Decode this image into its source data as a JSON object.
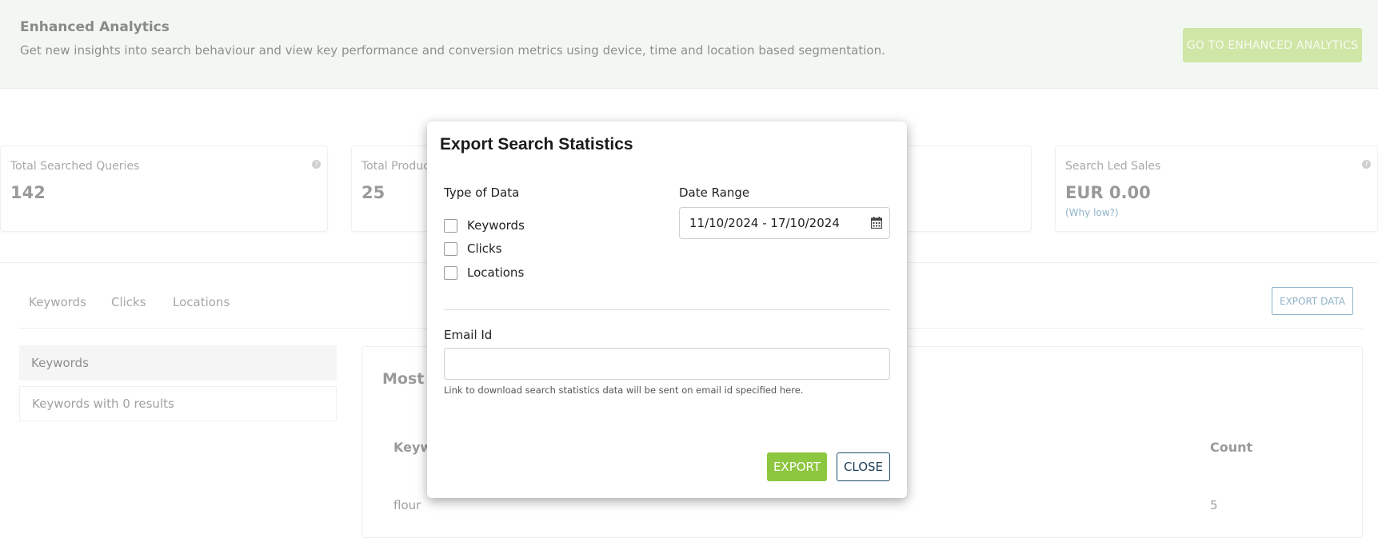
{
  "banner": {
    "title": "Enhanced Analytics",
    "description": "Get new insights into search behaviour and view key performance and conversion metrics using device, time and location based segmentation.",
    "button_label": "GO TO ENHANCED ANALYTICS"
  },
  "stats": [
    {
      "label": "Total Searched Queries",
      "value": "142"
    },
    {
      "label": "Total Produc",
      "value": "25"
    },
    {
      "label": "Search Led Sales",
      "value": "EUR 0.00",
      "link": "(Why low?)"
    }
  ],
  "tabs": [
    "Keywords",
    "Clicks",
    "Locations"
  ],
  "export_data_label": "EXPORT DATA",
  "sidebar": {
    "items": [
      {
        "label": "Keywords",
        "active": true
      },
      {
        "label": "Keywords with 0 results",
        "active": false
      }
    ]
  },
  "table": {
    "title_partial": "Most f",
    "headers": [
      "Keyw",
      "Count"
    ],
    "rows": [
      {
        "keyword": "flour",
        "count": "5"
      }
    ]
  },
  "modal": {
    "title": "Export Search Statistics",
    "type_label": "Type of Data",
    "options": [
      "Keywords",
      "Clicks",
      "Locations"
    ],
    "date_label": "Date Range",
    "date_value": "11/10/2024 - 17/10/2024",
    "email_label": "Email Id",
    "email_value": "",
    "help_text": "Link to download search statistics data will be sent on email id specified here.",
    "export_label": "EXPORT",
    "close_label": "CLOSE"
  },
  "colors": {
    "accent_green": "#8dc63f",
    "close_border": "#1f4e6b",
    "banner_bg": "#f2f8f1"
  }
}
